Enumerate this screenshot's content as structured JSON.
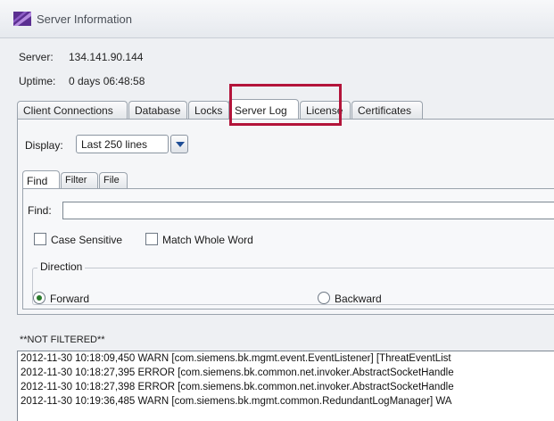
{
  "window": {
    "title": "Server Information"
  },
  "info": {
    "server_label": "Server:",
    "server_value": "134.141.90.144",
    "uptime_label": "Uptime:",
    "uptime_value": "0 days 06:48:58"
  },
  "tabs": [
    {
      "label": "Client Connections"
    },
    {
      "label": "Database"
    },
    {
      "label": "Locks"
    },
    {
      "label": "Server Log",
      "active": true
    },
    {
      "label": "License"
    },
    {
      "label": "Certificates"
    }
  ],
  "display": {
    "label": "Display:",
    "value": "Last 250 lines"
  },
  "subtabs": [
    {
      "label": "Find",
      "active": true
    },
    {
      "label": "Filter"
    },
    {
      "label": "File"
    }
  ],
  "find": {
    "label": "Find:",
    "value": "",
    "case_sensitive_label": "Case Sensitive",
    "match_whole_word_label": "Match Whole Word",
    "direction_label": "Direction",
    "forward_label": "Forward",
    "backward_label": "Backward",
    "selected_direction": "Forward"
  },
  "filter_status": "**NOT FILTERED**",
  "log_lines": [
    "2012-11-30 10:18:09,450 WARN  [com.siemens.bk.mgmt.event.EventListener] [ThreatEventList",
    "2012-11-30 10:18:27,395 ERROR [com.siemens.bk.common.net.invoker.AbstractSocketHandle",
    "2012-11-30 10:18:27,398 ERROR [com.siemens.bk.common.net.invoker.AbstractSocketHandle",
    "2012-11-30 10:19:36,485 WARN  [com.siemens.bk.mgmt.common.RedundantLogManager] WA"
  ],
  "colors": {
    "highlight": "#b3143a",
    "app_icon": "#6b3fa0"
  }
}
